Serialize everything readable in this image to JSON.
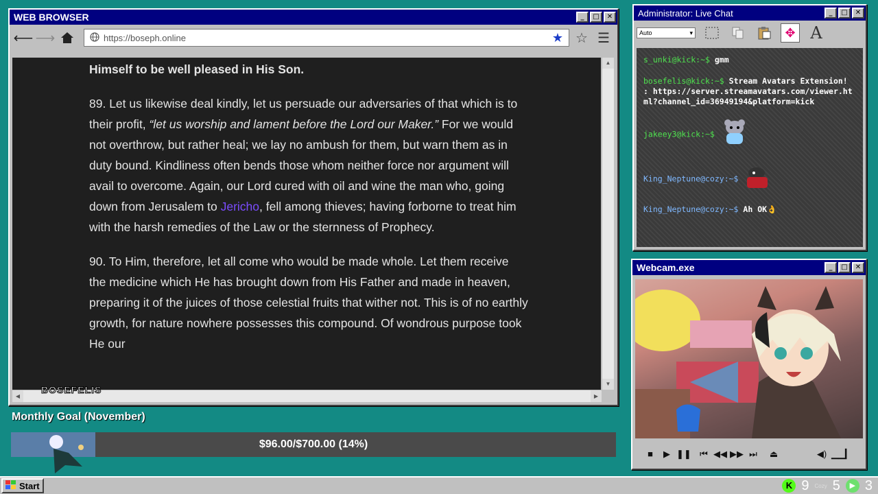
{
  "browser": {
    "title": "WEB BROWSER",
    "url": "https://boseph.online",
    "content": {
      "heading": "Himself to be well pleased in His Son.",
      "p89_a": "89. Let us likewise deal kindly, let us persuade our adversaries of that which is to their profit, ",
      "p89_quote": "“let us worship and lament before the Lord our Maker.”",
      "p89_b": " For we would not overthrow, but rather heal; we lay no ambush for them, but warn them as in duty bound. Kindliness often bends those whom neither force nor argument will avail to overcome. Again, our Lord cured with oil and wine the man who, going down from Jerusalem to ",
      "p89_link": "Jericho",
      "p89_c": ", fell among thieves; having forborne to treat him with the harsh remedies of the Law or the sternness of Prophecy.",
      "p90": "90. To Him, therefore, let all come who would be made whole. Let them receive the medicine which He has brought down from His Father and made in heaven, preparing it of the juices of those celestial fruits that wither not. This is of no earthly growth, for nature nowhere possesses this compound. Of wondrous purpose took He our"
    },
    "watermark": "BOSEFELIS"
  },
  "chat": {
    "title": "Administrator: Live Chat",
    "select_value": "Auto",
    "messages": [
      {
        "user": "s_unki@kick:~$",
        "text": "gmm"
      },
      {
        "user": "bosefelis@kick:~$",
        "text": "Stream Avatars Extension! : https://server.streamavatars.com/viewer.html?channel_id=36949194&platform=kick"
      },
      {
        "user": "jakeey3@kick:~$",
        "text": ""
      },
      {
        "user": "King_Neptune@cozy:~$",
        "text": ""
      },
      {
        "user": "King_Neptune@cozy:~$",
        "text": "Ah OK👌"
      }
    ]
  },
  "webcam": {
    "title": "Webcam.exe"
  },
  "goal": {
    "label": "Monthly Goal (November)",
    "text": "$96.00/$700.00 (14%)",
    "fraction": 0.14
  },
  "taskbar": {
    "start": "Start",
    "tray_kick": "9",
    "tray_cozy": "5",
    "tray_play": "3",
    "cozy_label": "Cozy"
  },
  "colors": {
    "title_bar": "#000080",
    "desktop": "#138a84",
    "kick_green": "#53fc18"
  }
}
